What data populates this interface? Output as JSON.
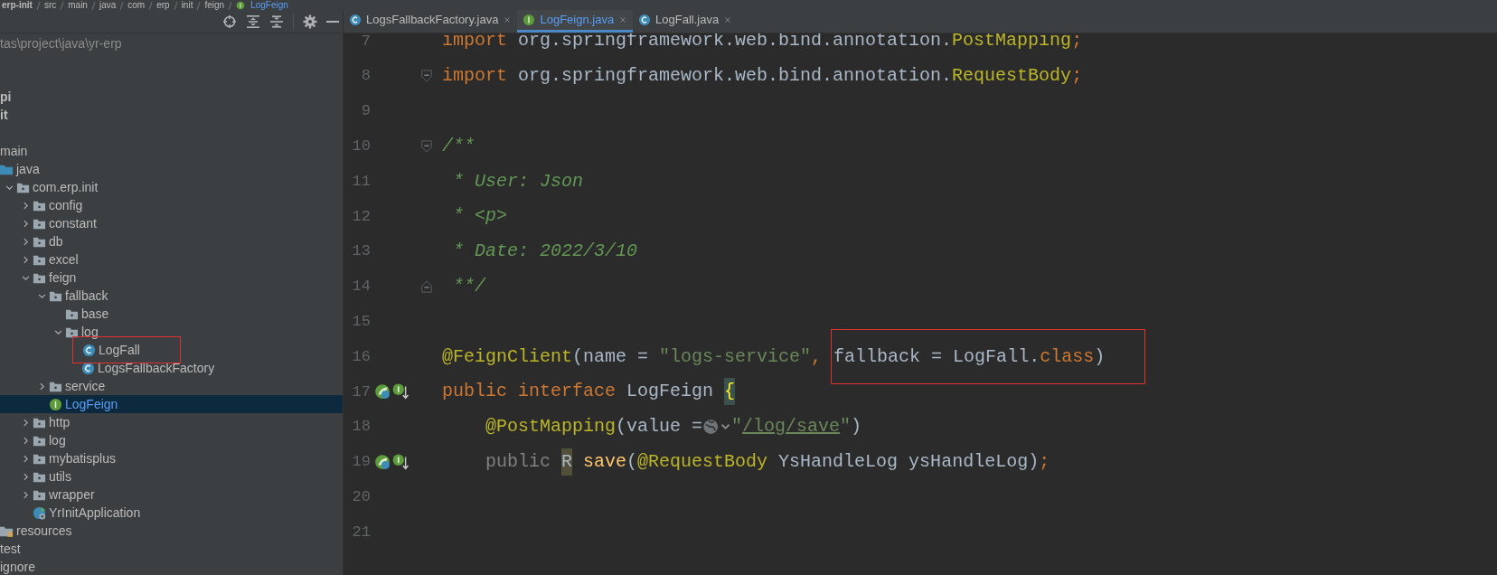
{
  "breadcrumbs": [
    {
      "label": "erp-init",
      "kind": "module"
    },
    {
      "label": "src",
      "kind": "folder"
    },
    {
      "label": "main",
      "kind": "folder"
    },
    {
      "label": "java",
      "kind": "folder"
    },
    {
      "label": "com",
      "kind": "folder"
    },
    {
      "label": "erp",
      "kind": "folder"
    },
    {
      "label": "init",
      "kind": "folder"
    },
    {
      "label": "feign",
      "kind": "folder"
    },
    {
      "label": "LogFeign",
      "kind": "interface"
    }
  ],
  "project": {
    "path": "tas\\project\\java\\yr-erp",
    "modules": [
      {
        "label": "pi"
      },
      {
        "label": "it"
      }
    ],
    "tree": [
      {
        "label": "main",
        "children": [
          {
            "label": "java",
            "kind": "source",
            "children": [
              {
                "label": "com.erp.init",
                "kind": "package",
                "expanded": true,
                "children": [
                  {
                    "label": "config",
                    "kind": "package",
                    "expanded": false
                  },
                  {
                    "label": "constant",
                    "kind": "package",
                    "expanded": false
                  },
                  {
                    "label": "db",
                    "kind": "package",
                    "expanded": false
                  },
                  {
                    "label": "excel",
                    "kind": "package",
                    "expanded": false
                  },
                  {
                    "label": "feign",
                    "kind": "package",
                    "expanded": true,
                    "children": [
                      {
                        "label": "fallback",
                        "kind": "package",
                        "expanded": true,
                        "children": [
                          {
                            "label": "base",
                            "kind": "package"
                          },
                          {
                            "label": "log",
                            "kind": "package",
                            "expanded": true,
                            "children": [
                              {
                                "label": "LogFall",
                                "kind": "class",
                                "outlined": true
                              },
                              {
                                "label": "LogsFallbackFactory",
                                "kind": "class"
                              }
                            ]
                          }
                        ]
                      },
                      {
                        "label": "service",
                        "kind": "package",
                        "expanded": false
                      },
                      {
                        "label": "LogFeign",
                        "kind": "interface",
                        "selected": true
                      }
                    ]
                  },
                  {
                    "label": "http",
                    "kind": "package",
                    "expanded": false
                  },
                  {
                    "label": "log",
                    "kind": "package",
                    "expanded": false
                  },
                  {
                    "label": "mybatisplus",
                    "kind": "package",
                    "expanded": false
                  },
                  {
                    "label": "utils",
                    "kind": "package",
                    "expanded": false
                  },
                  {
                    "label": "wrapper",
                    "kind": "package",
                    "expanded": false
                  },
                  {
                    "label": "YrInitApplication",
                    "kind": "app"
                  }
                ]
              }
            ]
          },
          {
            "label": "resources",
            "kind": "resources"
          }
        ]
      },
      {
        "label": "test"
      },
      {
        "label": "ignore"
      }
    ]
  },
  "tabs": [
    {
      "label": "LogsFallbackFactory.java",
      "kind": "class",
      "selected": false
    },
    {
      "label": "LogFeign.java",
      "kind": "interface",
      "selected": true
    },
    {
      "label": "LogFall.java",
      "kind": "class",
      "selected": false
    }
  ],
  "editor": {
    "lines": [
      {
        "number": "7",
        "tokens": [
          {
            "text": "import ",
            "kind": "keyword"
          },
          {
            "text": "org.springframework.web.bind.annotation.",
            "kind": "plain"
          },
          {
            "text": "PostMapping",
            "kind": "annotation"
          },
          {
            "text": ";",
            "kind": "keyword"
          }
        ]
      },
      {
        "number": "8",
        "gutter": [
          {
            "kind": "fold-start"
          }
        ],
        "tokens": [
          {
            "text": "import ",
            "kind": "keyword"
          },
          {
            "text": "org.springframework.web.bind.annotation.",
            "kind": "plain"
          },
          {
            "text": "RequestBody",
            "kind": "annotation"
          },
          {
            "text": ";",
            "kind": "keyword"
          }
        ]
      },
      {
        "number": "9"
      },
      {
        "number": "10",
        "gutter": [
          {
            "kind": "fold-start"
          }
        ],
        "tokens": [
          {
            "text": "/**",
            "kind": "comment"
          }
        ]
      },
      {
        "number": "11",
        "tokens": [
          {
            "text": " * User: Json",
            "kind": "comment"
          }
        ]
      },
      {
        "number": "12",
        "tokens": [
          {
            "text": " * <p>",
            "kind": "comment"
          }
        ]
      },
      {
        "number": "13",
        "tokens": [
          {
            "text": " * Date: 2022/3/10",
            "kind": "comment"
          }
        ]
      },
      {
        "number": "14",
        "gutter": [
          {
            "kind": "fold-end"
          }
        ],
        "tokens": [
          {
            "text": " **/",
            "kind": "comment"
          }
        ]
      },
      {
        "number": "15"
      },
      {
        "number": "16",
        "tokens": [
          {
            "text": "@FeignClient",
            "kind": "annotation"
          },
          {
            "text": "(name = ",
            "kind": "plain"
          },
          {
            "text": "\"logs-service\"",
            "kind": "string"
          },
          {
            "text": ", ",
            "kind": "keyword"
          },
          {
            "text": "fallback = LogFall.",
            "kind": "plain",
            "outlined": true
          },
          {
            "text": "class",
            "kind": "keyword",
            "outlined": true
          },
          {
            "text": ")",
            "kind": "plain",
            "outlined": true
          }
        ]
      },
      {
        "number": "17",
        "gutter": [
          {
            "kind": "bean"
          },
          {
            "kind": "interface"
          }
        ],
        "tokens": [
          {
            "text": "public interface ",
            "kind": "keyword"
          },
          {
            "text": "LogFeign ",
            "kind": "plain"
          },
          {
            "text": "{",
            "kind": "brace"
          }
        ]
      },
      {
        "number": "18",
        "indented": true,
        "tokens": [
          {
            "text": "@PostMapping",
            "kind": "annotation"
          },
          {
            "text": "(value =",
            "kind": "plain"
          },
          {
            "kind": "inlay"
          },
          {
            "text": "\"",
            "kind": "string"
          },
          {
            "text": "/log/save",
            "kind": "link"
          },
          {
            "text": "\"",
            "kind": "string"
          },
          {
            "text": ")",
            "kind": "plain"
          }
        ]
      },
      {
        "number": "19",
        "indented": true,
        "gutter": [
          {
            "kind": "bean"
          },
          {
            "kind": "interface"
          }
        ],
        "tokens": [
          {
            "text": "public ",
            "kind": "muted"
          },
          {
            "text": "R",
            "kind": "usage"
          },
          {
            "text": " save",
            "kind": "method"
          },
          {
            "text": "(",
            "kind": "plain"
          },
          {
            "text": "@RequestBody",
            "kind": "annotation"
          },
          {
            "text": " YsHandleLog ysHandleLog)",
            "kind": "plain"
          },
          {
            "text": ";",
            "kind": "keyword"
          }
        ]
      },
      {
        "number": "20"
      },
      {
        "number": "21"
      }
    ]
  }
}
